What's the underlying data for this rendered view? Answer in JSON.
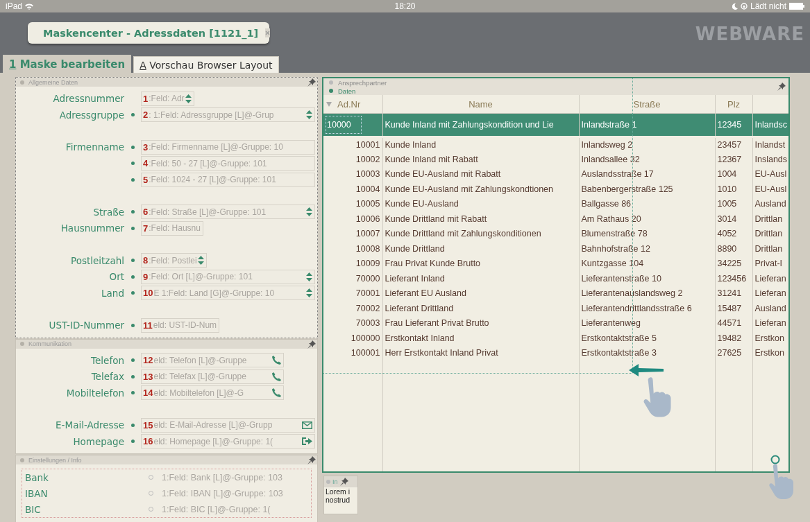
{
  "status_bar": {
    "device": "iPad",
    "time": "18:20",
    "charging": "Lädt nicht"
  },
  "window": {
    "title": "Maskencenter - Adressdaten [1121_1]",
    "logo": "WEBWARE"
  },
  "tabs": [
    {
      "label": "1 Maske bearbeiten",
      "selected": true
    },
    {
      "label": "A Vorschau Browser Layout",
      "selected": false
    }
  ],
  "sections": [
    {
      "title": "Allgemeine Daten",
      "groups": [
        [
          {
            "label": "Adressnummer",
            "required": false,
            "number": "1",
            "value": ":Feld: Adr",
            "kind": "spinner"
          },
          {
            "label": "Adressgruppe",
            "required": true,
            "number": "2",
            "value": ":  1:Feld: Adressgruppe  [L]@-Grup",
            "kind": "spinner"
          }
        ],
        [
          {
            "label": "Firmenname",
            "required": true,
            "number": "3",
            "value": ":Feld: Firmenname  [L]@-Gruppe: 10",
            "kind": "text"
          },
          {
            "required": true,
            "number": "4",
            "value": ":Feld: 50 - 27 [L]@-Gruppe: 101",
            "kind": "text"
          },
          {
            "required": true,
            "number": "5",
            "value": ":Feld: 1024 - 27 [L]@-Gruppe: 101",
            "kind": "text"
          }
        ],
        [
          {
            "label": "Straße",
            "required": true,
            "number": "6",
            "value": ":Feld: Straße  [L]@-Gruppe: 101",
            "kind": "spinner"
          },
          {
            "label": "Hausnummer",
            "required": true,
            "number": "7",
            "value": ":Feld: Hausnu",
            "kind": "text"
          }
        ],
        [
          {
            "label": "Postleitzahl",
            "required": true,
            "number": "8",
            "value": ":Feld: Postlei",
            "kind": "spinner"
          },
          {
            "label": "Ort",
            "required": true,
            "number": "9",
            "value": ":Feld: Ort  [L]@-Gruppe: 101",
            "kind": "spinner"
          },
          {
            "label": "Land",
            "required": true,
            "number": "10",
            "value": "E  1:Feld: Land  [G]@-Gruppe: 10",
            "kind": "spinner"
          }
        ],
        [
          {
            "label": "UST-ID-Nummer",
            "required": true,
            "number": "11",
            "value": "eld: UST-ID-Num",
            "kind": "text"
          }
        ]
      ]
    },
    {
      "title": "Kommunikation",
      "groups": [
        [
          {
            "label": "Telefon",
            "required": true,
            "number": "12",
            "value": "eld: Telefon  [L]@-Gruppe",
            "kind": "phone"
          },
          {
            "label": "Telefax",
            "required": true,
            "number": "13",
            "value": "eld: Telefax  [L]@-Gruppe",
            "kind": "phone"
          },
          {
            "label": "Mobiltelefon",
            "required": true,
            "number": "14",
            "value": "eld: Mobiltelefon  [L]@-G",
            "kind": "phone"
          }
        ],
        [
          {
            "label": "E-Mail-Adresse",
            "required": true,
            "number": "15",
            "value": "eld: E-Mail-Adresse  [L]@-Grupp",
            "kind": "mail"
          },
          {
            "label": "Homepage",
            "required": true,
            "number": "16",
            "value": "eld: Homepage  [L]@-Gruppe: 1(",
            "kind": "link"
          }
        ]
      ]
    }
  ],
  "settings": {
    "title": "Einstellungen / Info",
    "rows": [
      {
        "label": "Bank",
        "selected": false,
        "value": "1:Feld: Bank  [L]@-Gruppe: 103"
      },
      {
        "label": "IBAN",
        "selected": false,
        "value": "1:Feld: IBAN  [L]@-Gruppe: 103"
      },
      {
        "label": "BIC",
        "selected": false,
        "value": "1:Feld: BIC  [L]@-Gruppe: 1("
      }
    ]
  },
  "grid_panel": {
    "headers": [
      {
        "title": "Ansprechpartner",
        "active": false
      },
      {
        "title": "Daten",
        "active": true
      }
    ],
    "columns": [
      "Ad.Nr",
      "Name",
      "Straße",
      "Plz"
    ],
    "rows": [
      {
        "selected": true,
        "cells": [
          "10000",
          "Kunde Inland mit Zahlungskondition und Lie",
          "Inlandstraße 1",
          "12345",
          "Inlandsc"
        ]
      },
      {
        "selected": false,
        "cells": [
          "10001",
          "Kunde Inland",
          "Inlandsweg 2",
          "23457",
          "Inlandst"
        ]
      },
      {
        "selected": false,
        "cells": [
          "10002",
          "Kunde Inland mit Rabatt",
          "Inlandsallee 32",
          "12367",
          "Inslands"
        ]
      },
      {
        "selected": false,
        "cells": [
          "10003",
          "Kunde EU-Ausland mit Rabatt",
          "Auslandsstraße 17",
          "1004",
          "EU-Ausl"
        ]
      },
      {
        "selected": false,
        "cells": [
          "10004",
          "Kunde EU-Ausland mit Zahlungskondtionen",
          "Babenbergerstraße 125",
          "1010",
          "EU-Ausl"
        ]
      },
      {
        "selected": false,
        "cells": [
          "10005",
          "Kunde EU-Ausland",
          "Ballgasse 86",
          "1005",
          "Ausland"
        ]
      },
      {
        "selected": false,
        "cells": [
          "10006",
          "Kunde Drittland mit Rabatt",
          "Am Rathaus 20",
          "3014",
          "Drittlan"
        ]
      },
      {
        "selected": false,
        "cells": [
          "10007",
          "Kunde Drittland mit Zahlungskonditionen",
          "Blumenstraße 78",
          "4052",
          "Drittlan"
        ]
      },
      {
        "selected": false,
        "cells": [
          "10008",
          "Kunde Drittland",
          "Bahnhofstraße 12",
          "8890",
          "Drittlan"
        ]
      },
      {
        "selected": false,
        "cells": [
          "10009",
          "Frau Privat Kunde Brutto",
          "Kuntzgasse 104",
          "34225",
          "Privat-I"
        ]
      },
      {
        "selected": false,
        "cells": [
          "70000",
          "Lieferant Inland",
          "Lieferantenstraße 10",
          "123456",
          "Lieferan"
        ]
      },
      {
        "selected": false,
        "cells": [
          "70001",
          "Lieferant EU Ausland",
          "Lieferantenauslandsweg 2",
          "31241",
          "Lieferan"
        ]
      },
      {
        "selected": false,
        "cells": [
          "70002",
          "Lieferant Drittland",
          "Lieferantendrittlandsstraße 6",
          "15487",
          "Ausland"
        ]
      },
      {
        "selected": false,
        "cells": [
          "70003",
          "Frau Lieferant Privat Brutto",
          "Lieferantenweg",
          "44571",
          "Lieferan"
        ]
      },
      {
        "selected": false,
        "cells": [
          "100000",
          "Erstkontakt Inland",
          "Erstkontaktstraße 5",
          "19482",
          "Erstkon"
        ]
      },
      {
        "selected": false,
        "cells": [
          "100001",
          "Herr Erstkontakt Inland Privat",
          "Erstkontaktstraße 3",
          "27625",
          "Erstkon"
        ]
      }
    ]
  },
  "mini_panel": {
    "title": "In",
    "lines": [
      "Lorem i",
      "nostrud"
    ]
  }
}
